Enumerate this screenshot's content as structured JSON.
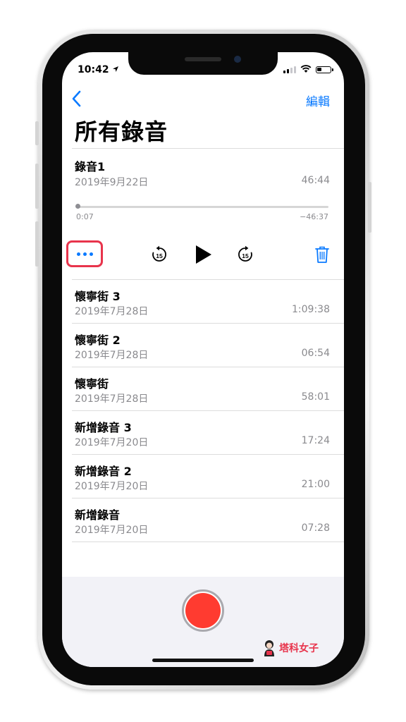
{
  "status": {
    "time": "10:42"
  },
  "nav": {
    "edit_label": "編輯"
  },
  "title": "所有錄音",
  "current": {
    "name": "錄音1",
    "date": "2019年9月22日",
    "duration": "46:44",
    "elapsed": "0:07",
    "remaining": "−46:37",
    "progress": 0.0025
  },
  "controls": {
    "more_icon": "more-ellipsis-icon",
    "rewind_icon": "skip-back-15-icon",
    "play_icon": "play-icon",
    "forward_icon": "skip-forward-15-icon",
    "trash_icon": "trash-icon",
    "skip_seconds": "15"
  },
  "recordings": [
    {
      "name": "懷寧街 3",
      "date": "2019年7月28日",
      "duration": "1:09:38"
    },
    {
      "name": "懷寧街 2",
      "date": "2019年7月28日",
      "duration": "06:54"
    },
    {
      "name": "懷寧街",
      "date": "2019年7月28日",
      "duration": "58:01"
    },
    {
      "name": "新增錄音 3",
      "date": "2019年7月20日",
      "duration": "17:24"
    },
    {
      "name": "新增錄音 2",
      "date": "2019年7月20日",
      "duration": "21:00"
    },
    {
      "name": "新增錄音",
      "date": "2019年7月20日",
      "duration": "07:28"
    }
  ],
  "watermark": {
    "text": "塔科女子"
  },
  "colors": {
    "accent": "#0a7aff",
    "record": "#ff3b30",
    "highlight": "#e8344c"
  }
}
